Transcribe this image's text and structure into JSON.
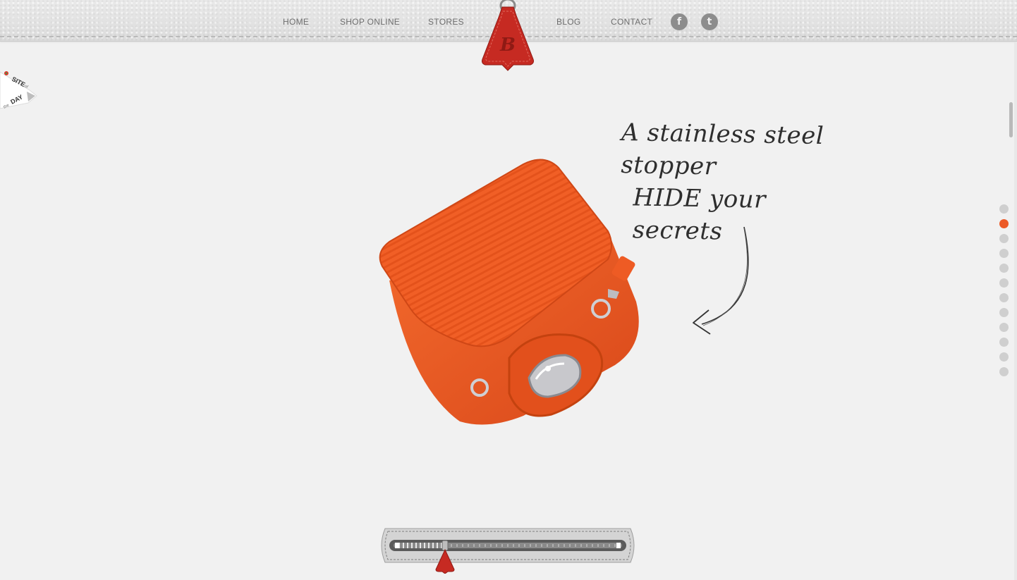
{
  "nav": {
    "home": "HOME",
    "shop": "SHOP ONLINE",
    "stores": "STORES",
    "blog": "BLOG",
    "contact": "CONTACT"
  },
  "social": {
    "facebook": "f",
    "twitter": "t"
  },
  "logo": {
    "letter": "B"
  },
  "badge": {
    "line1": "SITE",
    "of": "of",
    "the": "the",
    "line2": "DAY"
  },
  "hero": {
    "line1": "A stainless steel stopper",
    "line2": "HIDE your secrets"
  },
  "pager": {
    "count": 12,
    "active_index": 1
  },
  "colors": {
    "accent": "#ec5a27",
    "tag_red": "#c62a22",
    "bag_orange": "#f05a22"
  },
  "zipper": {
    "progress": 0.12
  }
}
